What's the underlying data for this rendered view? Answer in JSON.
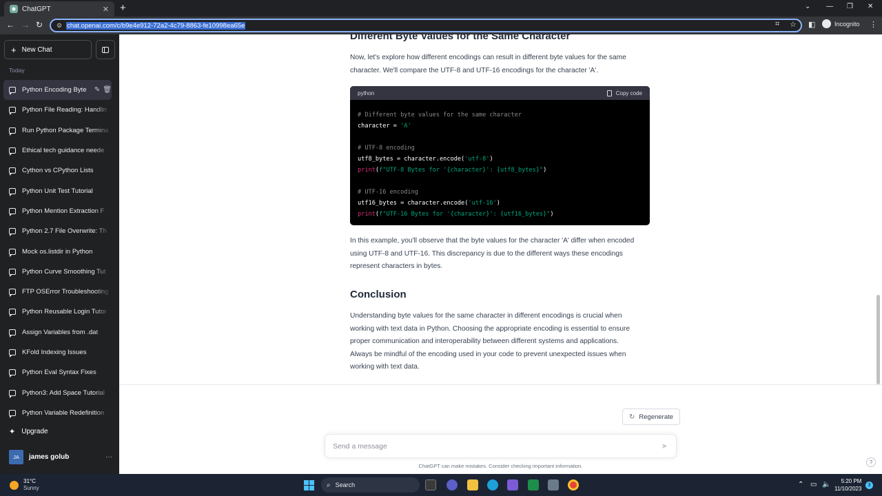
{
  "browser": {
    "tab_title": "ChatGPT",
    "url": "chat.openai.com/c/b9e4e912-72a2-4c79-8863-fe10998ea65e",
    "incognito_label": "Incognito"
  },
  "sidebar": {
    "new_chat_label": "New Chat",
    "section_label": "Today",
    "items": [
      {
        "label": "Python Encoding Byte"
      },
      {
        "label": "Python File Reading: Handlin"
      },
      {
        "label": "Run Python Package Termina"
      },
      {
        "label": "Ethical tech guidance neede"
      },
      {
        "label": "Cython vs CPython Lists"
      },
      {
        "label": "Python Unit Test Tutorial"
      },
      {
        "label": "Python Mention Extraction F"
      },
      {
        "label": "Python 2.7 File Overwrite: Th"
      },
      {
        "label": "Mock os.listdir in Python"
      },
      {
        "label": "Python Curve Smoothing Tut"
      },
      {
        "label": "FTP OSError Troubleshooting"
      },
      {
        "label": "Python Reusable Login Tutor"
      },
      {
        "label": "Assign Variables from .dat"
      },
      {
        "label": "KFold Indexing Issues"
      },
      {
        "label": "Python Eval Syntax Fixes"
      },
      {
        "label": "Python3: Add Space Tutorial"
      },
      {
        "label": "Python Variable Redefinition"
      }
    ],
    "upgrade_label": "Upgrade",
    "user": {
      "initials": "JA",
      "name": "james golub"
    }
  },
  "main": {
    "partial_heading": "Different Byte Values for the Same Character",
    "intro_line1": "Now, let's explore how different encodings can result in different byte values for the same",
    "intro_line2": "character. We'll compare the UTF-8 and UTF-16 encodings for the character 'A'.",
    "code": {
      "language": "python",
      "copy_label": "Copy code",
      "l1": "# Different byte values for the same character",
      "l2a": "character = ",
      "l2b": "'A'",
      "l4": "# UTF-8 encoding",
      "l5a": "utf8_bytes = character.encode(",
      "l5b": "'utf-8'",
      "l5c": ")",
      "l6a": "print",
      "l6b": "(",
      "l6c": "f\"UTF-8 Bytes for '{character}': {utf8_bytes}\"",
      "l6d": ")",
      "l8": "# UTF-16 encoding",
      "l9a": "utf16_bytes = character.encode(",
      "l9b": "'utf-16'",
      "l9c": ")",
      "l10a": "print",
      "l10b": "(",
      "l10c": "f\"UTF-16 Bytes for '{character}': {utf16_bytes}\"",
      "l10d": ")"
    },
    "example_line1": "In this example, you'll observe that the byte values for the character 'A' differ when encoded",
    "example_line2": "using UTF-8 and UTF-16. This discrepancy is due to the different ways these encodings",
    "example_line3": "represent characters in bytes.",
    "conclusion_heading": "Conclusion",
    "conclusion_line1": "Understanding byte values for the same character in different encodings is crucial when",
    "conclusion_line2": "working with text data in Python. Choosing the appropriate encoding is essential to ensure",
    "conclusion_line3": "proper communication and interoperability between different systems and applications.",
    "conclusion_line4": "Always be mindful of the encoding used in your code to prevent unexpected issues when",
    "conclusion_line5": "working with text data.",
    "regenerate_label": "Regenerate",
    "prompt_placeholder": "Send a message",
    "disclaimer": "ChatGPT can make mistakes. Consider checking important information.",
    "help_label": "?"
  },
  "taskbar": {
    "temperature": "31°C",
    "condition": "Sunny",
    "search_label": "Search",
    "time": "5:20 PM",
    "date": "11/10/2023",
    "notification_count": "3"
  },
  "colors": {
    "sidebar_bg": "#202123",
    "code_bg": "#000000",
    "code_string": "#00a67d",
    "code_function": "#df3079",
    "taskbar_bg": "#1c2433"
  }
}
